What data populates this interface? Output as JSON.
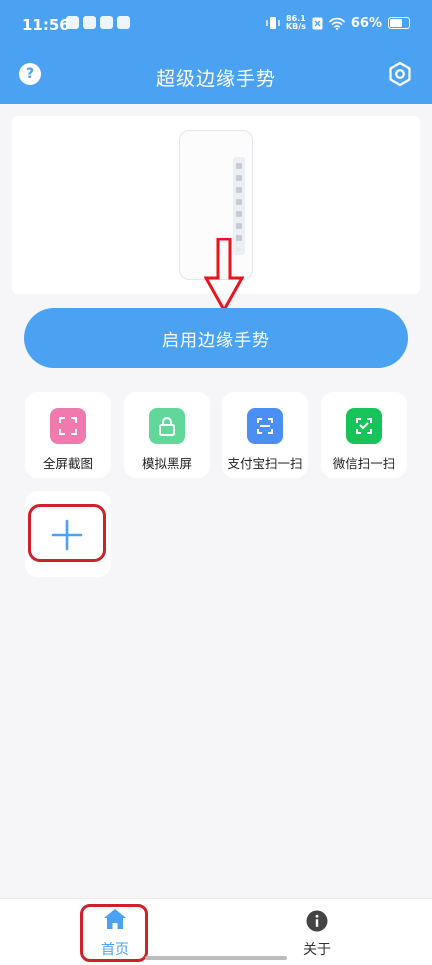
{
  "status_bar": {
    "time": "11:56",
    "net_speed": "86.1",
    "net_unit": "KB/s",
    "battery": "66%"
  },
  "app_bar": {
    "title": "超级边缘手势",
    "help_icon": "question-circle-icon",
    "settings_icon": "gear-hexagon-icon"
  },
  "main_button": {
    "label": "启用边缘手势"
  },
  "quick_actions": [
    {
      "label": "全屏截图",
      "icon": "screenshot-frame-icon",
      "color": "#f07aae"
    },
    {
      "label": "模拟黑屏",
      "icon": "lock-icon",
      "color": "#5fd89a"
    },
    {
      "label": "支付宝扫一扫",
      "icon": "scan-icon",
      "color": "#4b8ff5"
    },
    {
      "label": "微信扫一扫",
      "icon": "scan-icon",
      "color": "#17c45a"
    }
  ],
  "add_tile": {
    "icon": "plus-icon"
  },
  "bottom_nav": {
    "items": [
      {
        "label": "首页",
        "icon": "home-icon",
        "active": true
      },
      {
        "label": "关于",
        "icon": "info-icon",
        "active": false
      }
    ]
  },
  "colors": {
    "primary": "#4ba2f2",
    "highlight": "#d0202a",
    "annotation_arrow": "#e8141e"
  }
}
